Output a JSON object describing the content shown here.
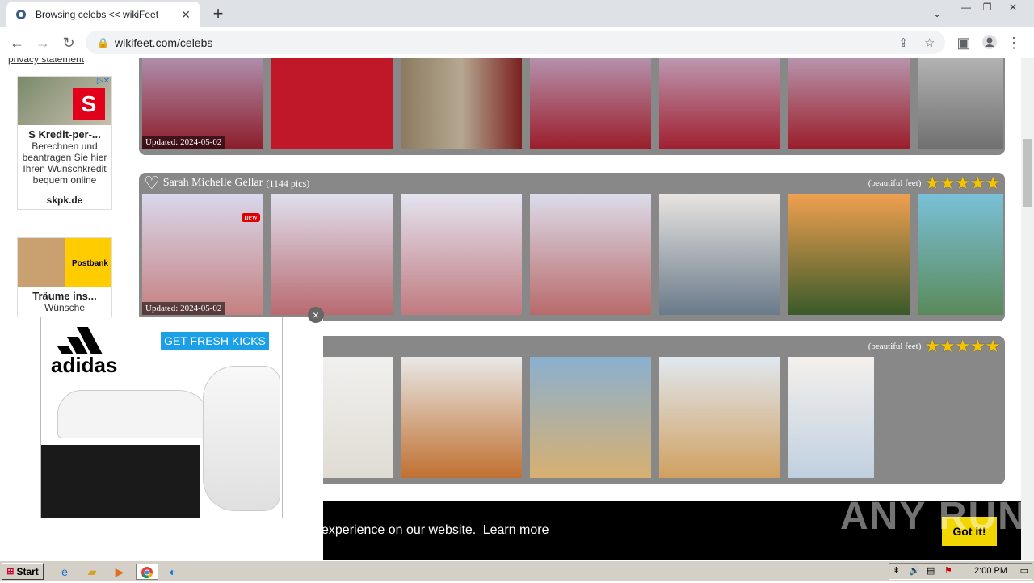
{
  "browser": {
    "tab_title": "Browsing celebs << wikiFeet",
    "new_tab": "+",
    "url": "wikifeet.com/celebs",
    "window_controls": [
      "—",
      "❐",
      "✕"
    ]
  },
  "sidebar": {
    "privacy_link": "privacy statement",
    "ads": [
      {
        "headline": "S Kredit-per-...",
        "desc": "Berechnen und beantragen Sie hier Ihren Wunschkredit bequem online",
        "domain": "skpk.de"
      },
      {
        "headline": "Träume ins...",
        "desc": "Wünsche",
        "brand": "Postbank"
      }
    ]
  },
  "rows": [
    {
      "name": "",
      "pics": "",
      "rating_label": "",
      "updated": "Updated: 2024-05-02",
      "new": true
    },
    {
      "name": "Sarah Michelle Gellar",
      "pics": "(1144 pics)",
      "rating_label": "(beautiful feet)",
      "stars": "★★★★★",
      "updated": "Updated: 2024-05-02",
      "new": true,
      "new_label": "new"
    },
    {
      "name": "",
      "pics": "",
      "rating_label": "(beautiful feet)",
      "stars": "★★★★★",
      "updated": "",
      "new": false
    }
  ],
  "adidas_ad": {
    "cta": "GET FRESH KICKS",
    "brand": "adidas",
    "close": "×"
  },
  "cookie": {
    "message": "experience on our website.",
    "learn_more": "Learn more",
    "button": "Got it!"
  },
  "watermark": "ANY RUN",
  "taskbar": {
    "start": "Start",
    "clock": "2:00 PM"
  }
}
